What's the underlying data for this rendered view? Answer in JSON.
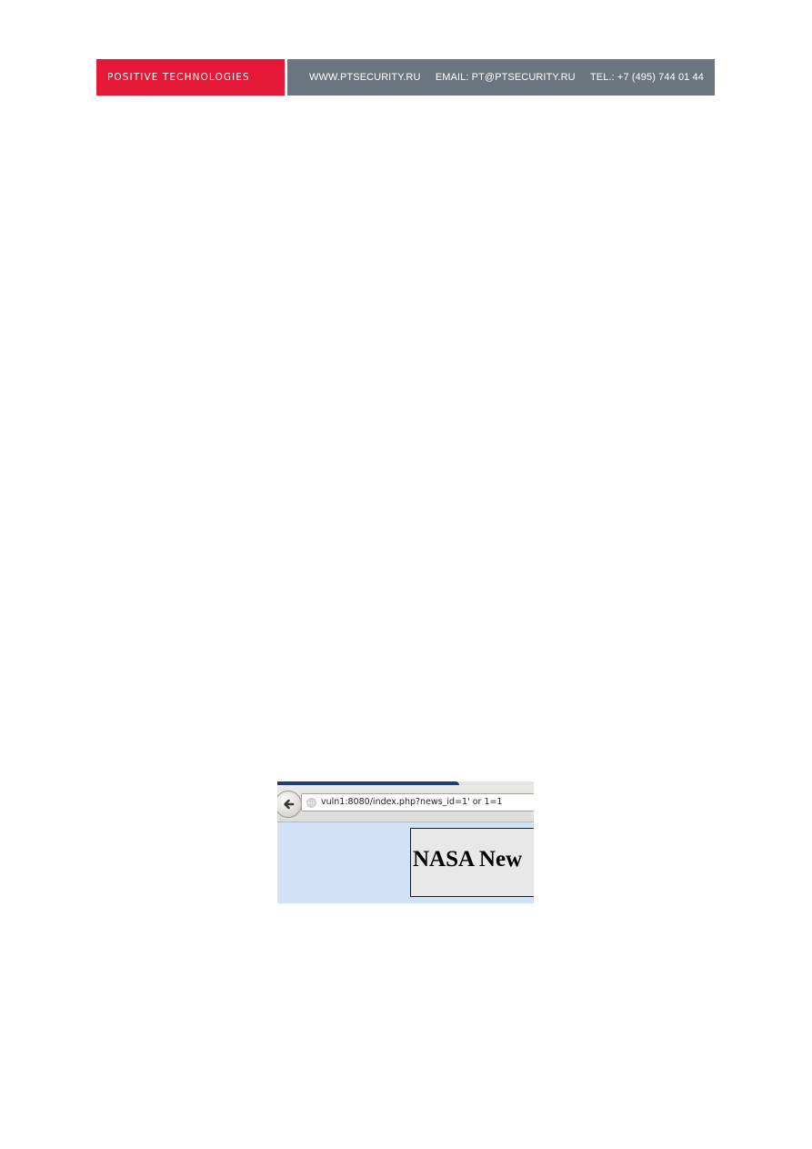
{
  "header": {
    "brand": "POSITIVE TECHNOLOGIES",
    "website": "WWW.PTSECURITY.RU",
    "email": "EMAIL: PT@PTSECURITY.RU",
    "phone": "TEL.: +7 (495) 744 01 44",
    "colors": {
      "brand_bg": "#e31937",
      "contact_bg": "#6b7580"
    }
  },
  "screenshot": {
    "url": "vuln1:8080/index.php?news_id=1' or 1=1",
    "banner_text": "NASA New",
    "icons": {
      "back": "back-arrow-icon",
      "site": "globe-icon"
    },
    "colors": {
      "page_bg": "#cfe2f6",
      "banner_bg": "#e8e8e8"
    }
  }
}
